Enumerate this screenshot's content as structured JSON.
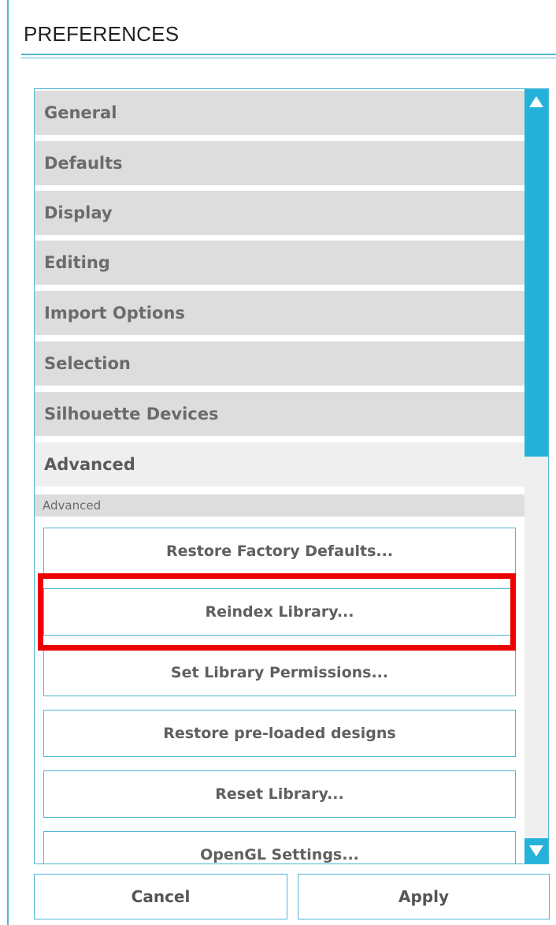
{
  "window": {
    "title": "PREFERENCES"
  },
  "sections": [
    {
      "label": "General"
    },
    {
      "label": "Defaults"
    },
    {
      "label": "Display"
    },
    {
      "label": "Editing"
    },
    {
      "label": "Import Options"
    },
    {
      "label": "Selection"
    },
    {
      "label": "Silhouette Devices"
    },
    {
      "label": "Advanced",
      "expanded": true
    }
  ],
  "advanced": {
    "subheader": "Advanced",
    "buttons": [
      {
        "label": "Restore Factory Defaults..."
      },
      {
        "label": "Reindex Library...",
        "highlighted": true
      },
      {
        "label": "Set Library Permissions..."
      },
      {
        "label": "Restore pre-loaded designs"
      },
      {
        "label": "Reset Library..."
      },
      {
        "label": "OpenGL Settings..."
      }
    ]
  },
  "footer": {
    "cancel_label": "Cancel",
    "apply_label": "Apply"
  },
  "colors": {
    "accent": "#24b2db",
    "border": "#4fb6d6",
    "highlight": "#ee0000"
  },
  "icons": {
    "scroll_up": "triangle-up-icon",
    "scroll_down": "triangle-down-icon"
  }
}
